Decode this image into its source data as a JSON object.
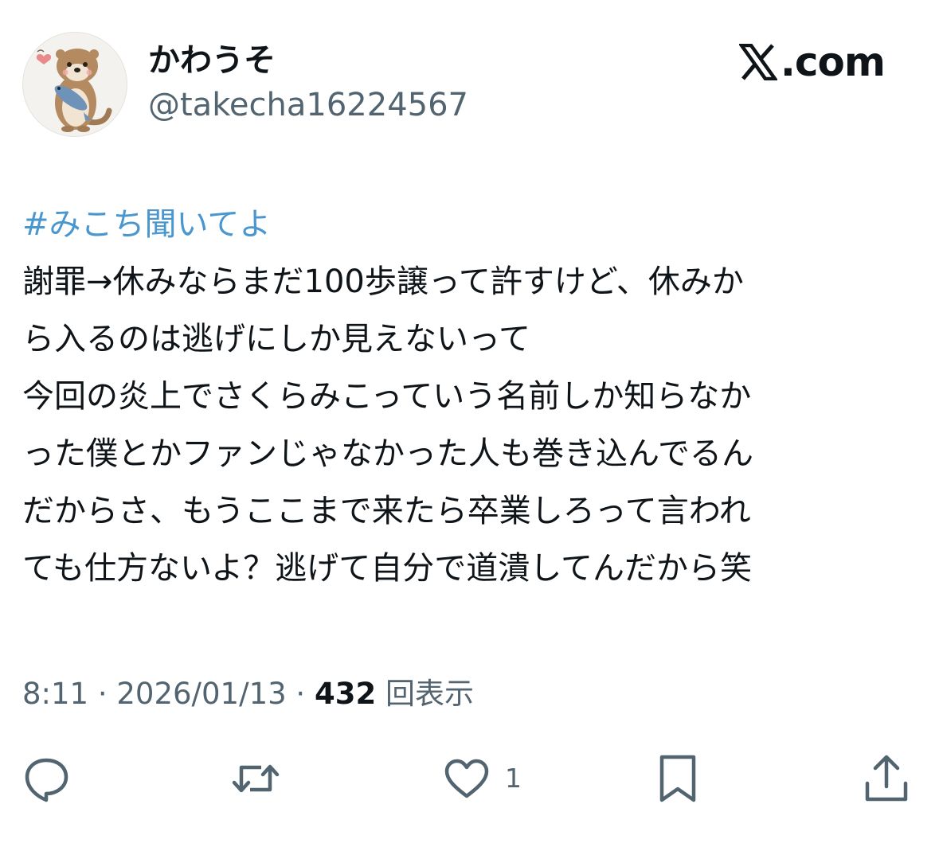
{
  "user": {
    "display_name": "かわうそ",
    "handle": "@takecha16224567",
    "avatar_icon": "otter-avatar-icon"
  },
  "brand": {
    "label": ".com",
    "icon": "x-logo-icon"
  },
  "tweet": {
    "hashtag": "#みこち聞いてよ",
    "lines": [
      "謝罪→休みならまだ100歩譲って許すけど、休みか",
      "ら入るのは逃げにしか見えないって",
      "今回の炎上でさくらみこっていう名前しか知らなか",
      "った僕とかファンじゃなかった人も巻き込んでるん",
      "だからさ、もうここまで来たら卒業しろって言われ",
      "ても仕方ないよ？逃げて自分で道潰してんだから笑"
    ]
  },
  "meta": {
    "time": "8:11",
    "separator": " · ",
    "date": "2026/01/13",
    "views_count": "432",
    "views_label": "回表示"
  },
  "actions": {
    "like_count": "1",
    "icons": [
      "reply-icon",
      "retweet-icon",
      "like-icon",
      "bookmark-icon",
      "share-icon"
    ]
  },
  "colors": {
    "text": "#0f1419",
    "secondary": "#536471",
    "hashtag": "#4a97cf",
    "background": "#ffffff"
  }
}
